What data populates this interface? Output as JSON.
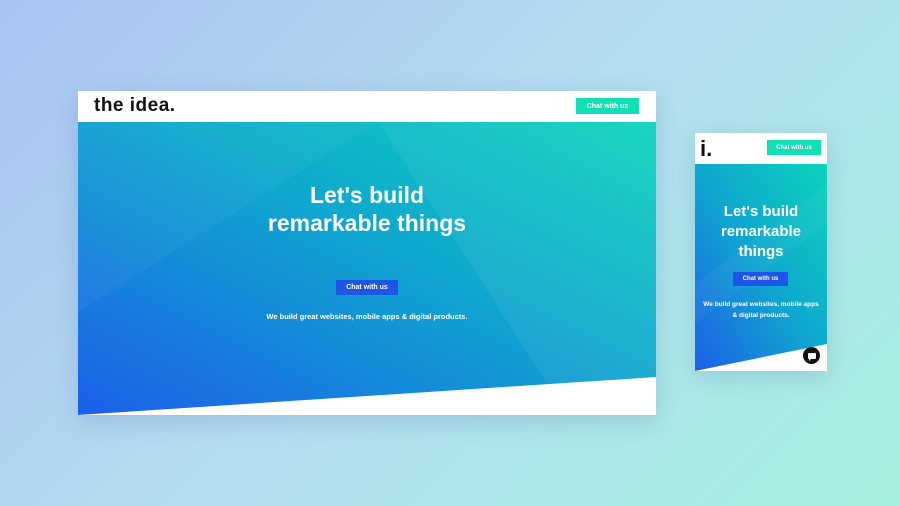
{
  "desktop": {
    "logo": "the idea.",
    "header_button": "Chat with us",
    "hero_title_line1": "Let's build",
    "hero_title_line2": "remarkable things",
    "hero_button": "Chat with us",
    "hero_subtitle": "We build great websites, mobile apps & digital products."
  },
  "mobile": {
    "logo": "i.",
    "header_button": "Chat with us",
    "hero_title_line1": "Let's build",
    "hero_title_line2": "remarkable",
    "hero_title_line3": "things",
    "hero_button": "Chat with us",
    "hero_subtitle_line1": "We build great websites, mobile apps",
    "hero_subtitle_line2": "& digital products.",
    "chat_icon": "chat-bubble-icon"
  },
  "colors": {
    "accent_green": "#12e0b4",
    "primary_blue": "#1d55e6",
    "gradient_start": "#1d62e8",
    "gradient_end": "#0ccdbb"
  }
}
